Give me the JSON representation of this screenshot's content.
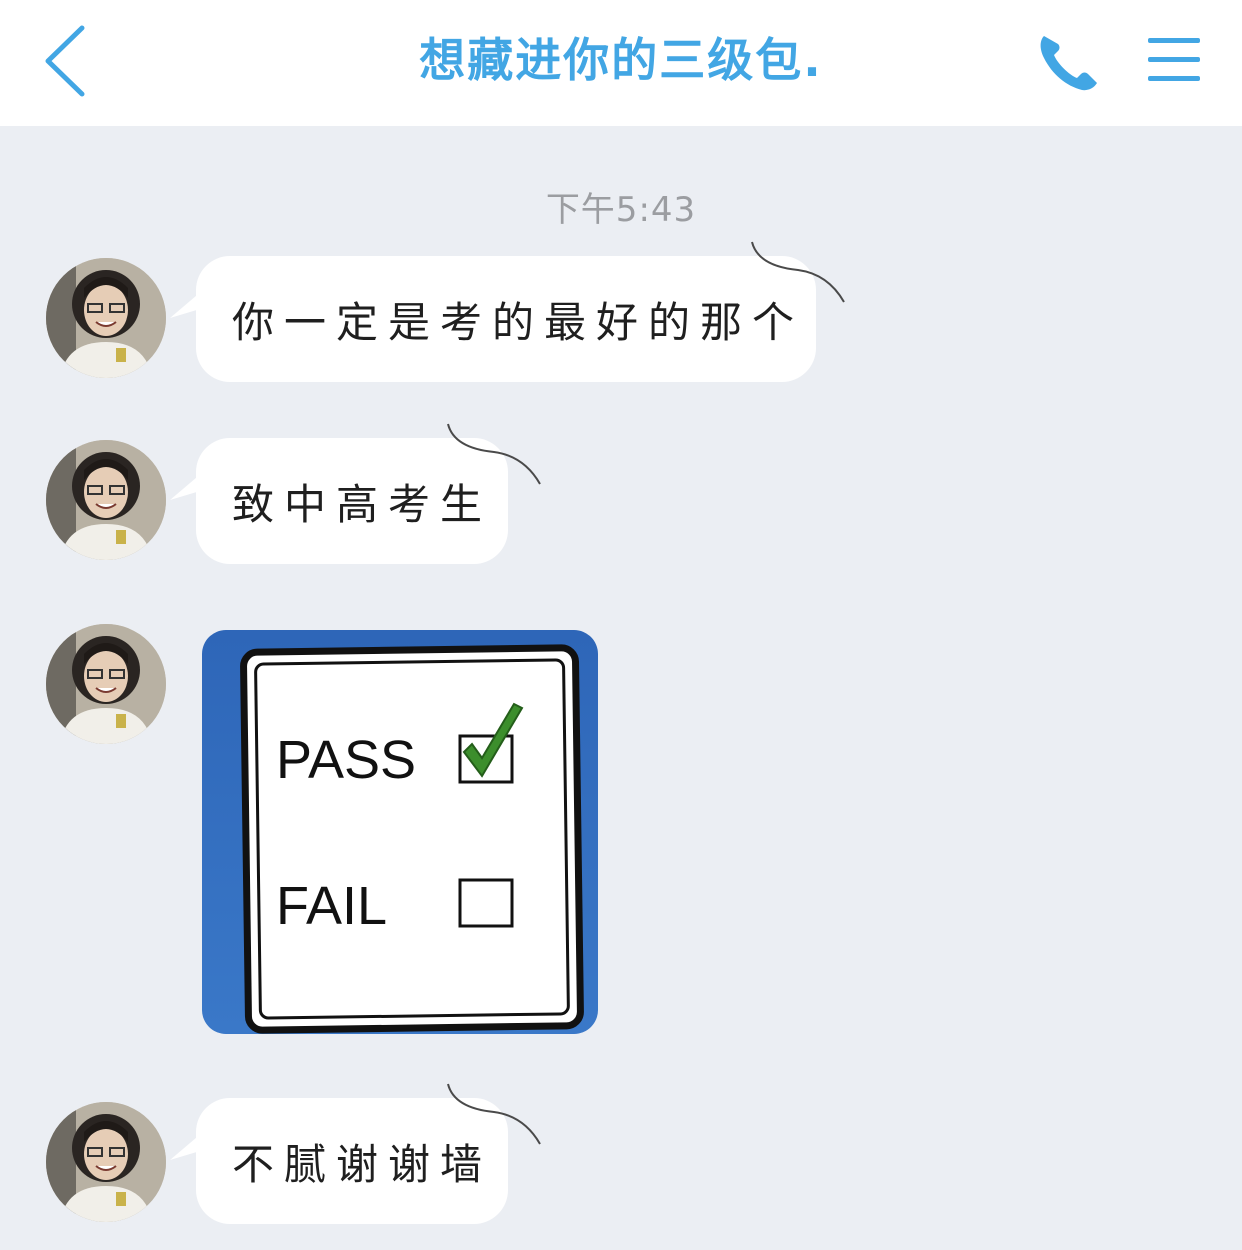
{
  "header": {
    "title": "想藏进你的三级包.",
    "back_icon": "chevron-left-icon",
    "call_icon": "phone-icon",
    "menu_icon": "menu-icon",
    "accent_color": "#42a6e4"
  },
  "chat": {
    "timestamp": "下午5:43",
    "messages": [
      {
        "type": "text",
        "text": "你一定是考的最好的那个"
      },
      {
        "type": "text",
        "text": "致中高考生"
      },
      {
        "type": "image",
        "sign": {
          "pass_label": "PASS",
          "fail_label": "FAIL",
          "pass_checked": true,
          "fail_checked": false
        }
      },
      {
        "type": "text",
        "text": "不腻谢谢墙"
      }
    ]
  }
}
